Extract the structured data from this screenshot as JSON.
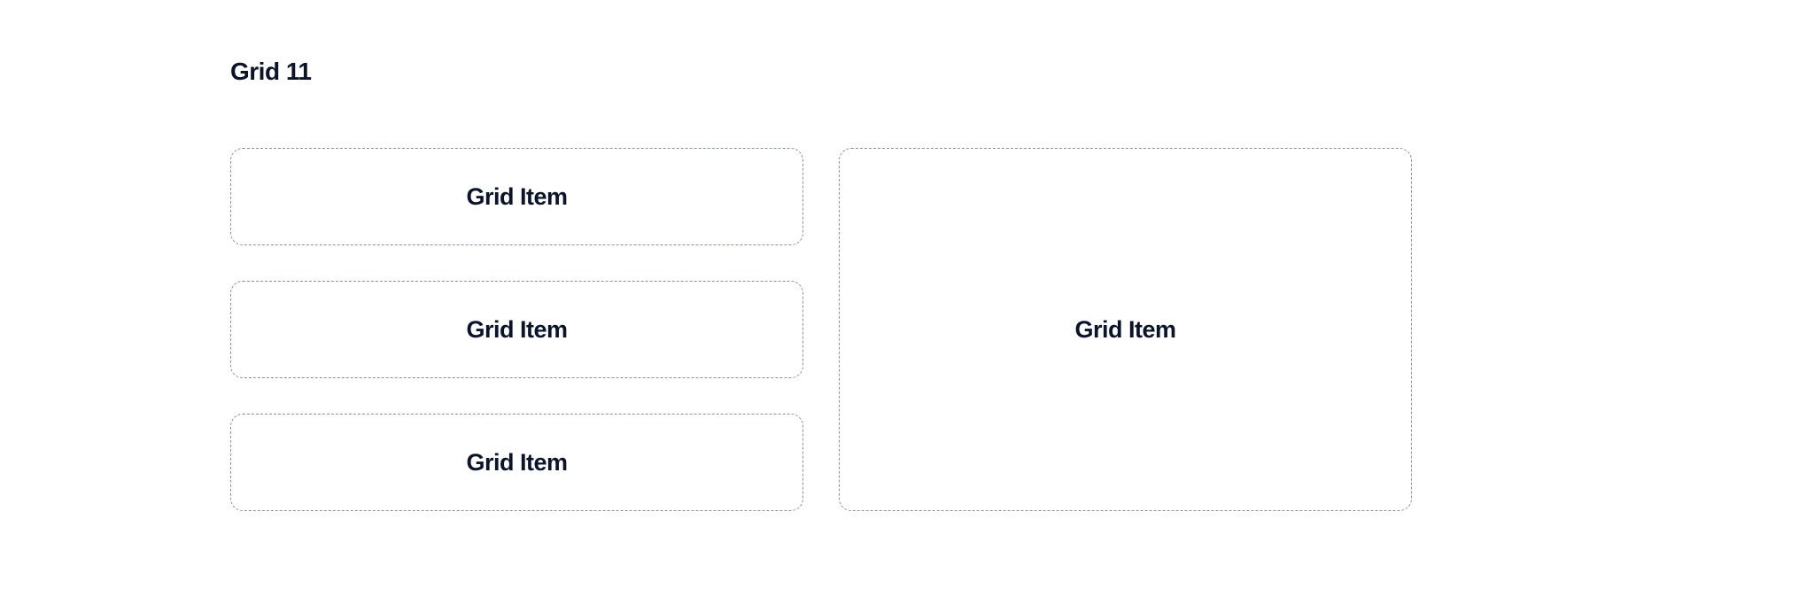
{
  "heading": "Grid 11",
  "grid": {
    "items": [
      {
        "label": "Grid Item"
      },
      {
        "label": "Grid Item"
      },
      {
        "label": "Grid Item"
      },
      {
        "label": "Grid Item"
      }
    ]
  }
}
